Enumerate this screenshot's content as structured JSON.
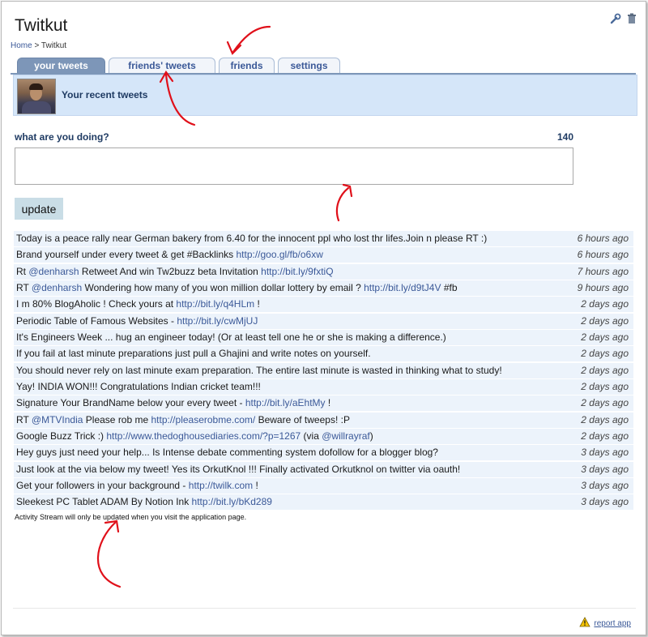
{
  "app": {
    "title": "Twitkut"
  },
  "top_icons": [
    "wrench-icon",
    "trash-icon"
  ],
  "breadcrumb": {
    "home": "Home",
    "separator": ">",
    "current": "Twitkut"
  },
  "tabs": [
    {
      "label": "your tweets",
      "active": true
    },
    {
      "label": "friends' tweets",
      "active": false
    },
    {
      "label": "friends",
      "active": false
    },
    {
      "label": "settings",
      "active": false
    }
  ],
  "header": {
    "title": "Your recent tweets"
  },
  "compose": {
    "label": "what are you doing?",
    "counter": "140",
    "value": "",
    "button_label": "update"
  },
  "feed": {
    "rows": [
      {
        "text": "Today is a peace rally near German bakery from 6.40 for the innocent ppl who lost thr lifes.Join n please RT :)",
        "time": "6 hours ago"
      },
      {
        "pre": "Brand yourself under every tweet & get #Backlinks ",
        "link": "http://goo.gl/fb/o6xw",
        "time": "6 hours ago"
      },
      {
        "pre": "Rt ",
        "mention": "@denharsh",
        "mid": " Retweet And win Tw2buzz beta Invitation ",
        "link": "http://bit.ly/9fxtiQ",
        "time": "7 hours ago"
      },
      {
        "pre": "RT ",
        "mention": "@denharsh",
        "mid": " Wondering how many of you won million dollar lottery by email ? ",
        "link": "http://bit.ly/d9tJ4V",
        "post": " #fb",
        "time": "9 hours ago"
      },
      {
        "pre": "I m 80% BlogAholic ! Check yours at ",
        "link": "http://bit.ly/q4HLm",
        "post": " !",
        "time": "2 days ago"
      },
      {
        "pre": "Periodic Table of Famous Websites - ",
        "link": "http://bit.ly/cwMjUJ",
        "time": "2 days ago"
      },
      {
        "text": "It's Engineers Week ... hug an engineer today! (Or at least tell one he or she is making a difference.)",
        "time": "2 days ago"
      },
      {
        "text": "If you fail at last minute preparations just pull a Ghajini and write notes on yourself.",
        "time": "2 days ago"
      },
      {
        "text": "You should never rely on last minute exam preparation. The entire last minute is wasted in thinking what to study!",
        "time": "2 days ago"
      },
      {
        "text": "Yay! INDIA WON!!! Congratulations Indian cricket team!!!",
        "time": "2 days ago"
      },
      {
        "pre": "Signature Your BrandName below your every tweet - ",
        "link": "http://bit.ly/aEhtMy",
        "post": " !",
        "time": "2 days ago"
      },
      {
        "pre": "RT ",
        "mention": "@MTVIndia",
        "mid": " Please rob me ",
        "link": "http://pleaserobme.com/",
        "post": " Beware of tweeps! :P",
        "time": "2 days ago"
      },
      {
        "pre": "Google Buzz Trick :) ",
        "link": "http://www.thedoghousediaries.com/?p=1267",
        "post": " (via ",
        "mention2": "@willrayraf",
        "post2": ")",
        "time": "2 days ago"
      },
      {
        "text": "Hey guys just need your help... Is Intense debate commenting system dofollow for a blogger blog?",
        "time": "3 days ago"
      },
      {
        "text": "Just look at the via below my tweet! Yes its OrkutKnol !!! Finally activated Orkutknol on twitter via oauth!",
        "time": "3 days ago"
      },
      {
        "pre": "Get your followers in your background - ",
        "link": "http://twilk.com",
        "post": " !",
        "time": "3 days ago"
      },
      {
        "pre": "Sleekest PC Tablet ADAM By Notion Ink ",
        "link": "http://bit.ly/bKd289",
        "time": "3 days ago"
      }
    ]
  },
  "footnote": "Activity Stream will only be updated when you visit the application page.",
  "footer": {
    "report_label": "report app",
    "report_icon": "warning-icon"
  },
  "colors": {
    "accent": "#3b5998",
    "tab_active": "#7d96b8",
    "row_bg": "#ecf3fb",
    "annotation": "#e0101a"
  }
}
